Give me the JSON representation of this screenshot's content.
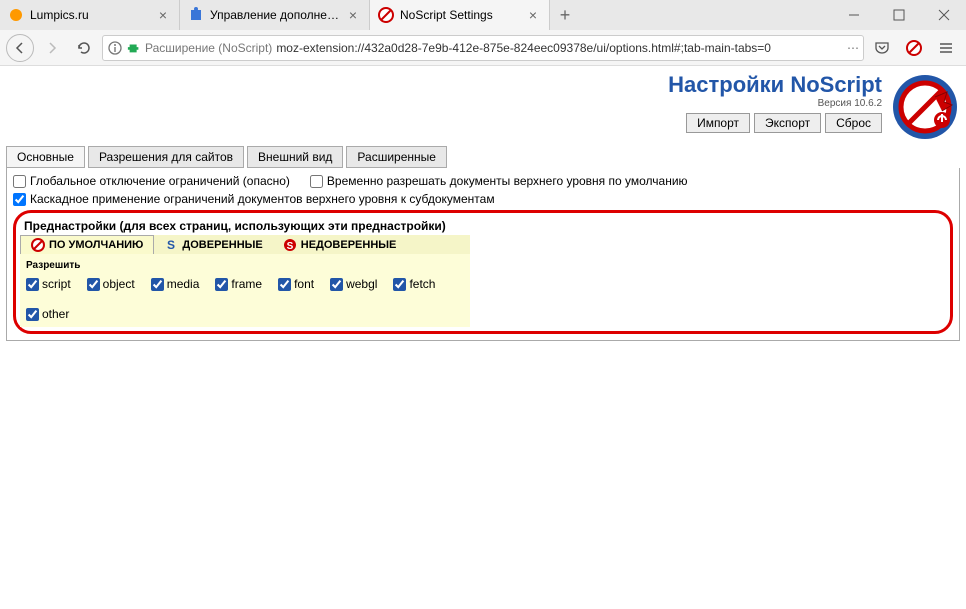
{
  "browser_tabs": [
    {
      "label": "Lumpics.ru",
      "active": false
    },
    {
      "label": "Управление дополнениями",
      "active": false
    },
    {
      "label": "NoScript Settings",
      "active": true
    }
  ],
  "urlbar": {
    "ext_label": "Расширение (NoScript)",
    "url": "moz-extension://432a0d28-7e9b-412e-875e-824eec09378e/ui/options.html#;tab-main-tabs=0"
  },
  "page": {
    "title": "Настройки NoScript",
    "version": "Версия 10.6.2"
  },
  "actions": {
    "import": "Импорт",
    "export": "Экспорт",
    "reset": "Сброс"
  },
  "ui_tabs": [
    "Основные",
    "Разрешения для сайтов",
    "Внешний вид",
    "Расширенные"
  ],
  "options": {
    "global_off": "Глобальное отключение ограничений (опасно)",
    "temp_allow": "Временно разрешать документы верхнего уровня по умолчанию",
    "cascade": "Каскадное применение ограничений документов верхнего уровня к субдокументам"
  },
  "presets": {
    "title": "Преднастройки (для всех страниц, использующих эти преднастройки)",
    "tabs": {
      "default": "ПО УМОЛЧАНИЮ",
      "trusted": "ДОВЕРЕННЫЕ",
      "untrusted": "НЕДОВЕРЕННЫЕ"
    },
    "allow_label": "Разрешить",
    "permissions": [
      "script",
      "object",
      "media",
      "frame",
      "font",
      "webgl",
      "fetch",
      "other"
    ]
  }
}
